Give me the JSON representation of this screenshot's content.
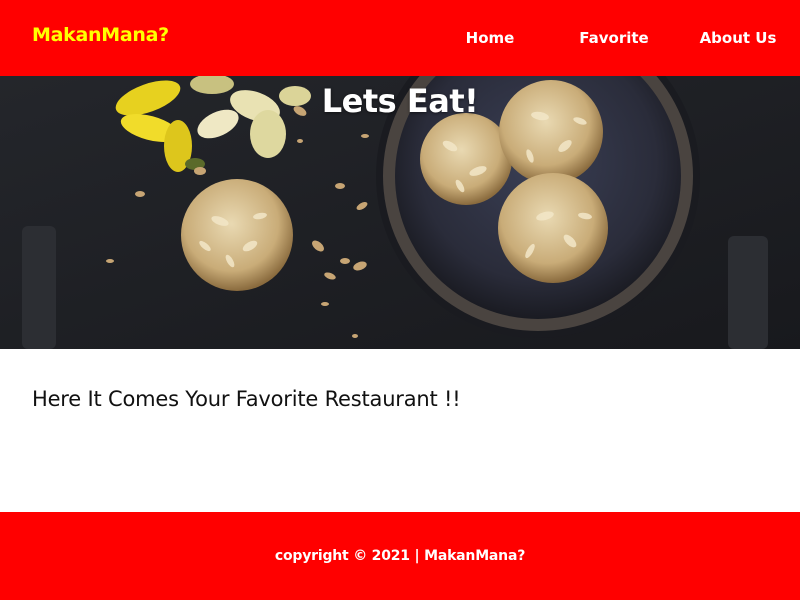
{
  "header": {
    "brand": "MakanMana?",
    "nav": [
      {
        "label": "Home"
      },
      {
        "label": "Favorite"
      },
      {
        "label": "About Us"
      }
    ]
  },
  "hero": {
    "title": "Lets Eat!",
    "image_alt": "cookies-with-almonds-and-daffodils"
  },
  "main": {
    "heading": "Here It Comes Your Favorite Restaurant !!"
  },
  "footer": {
    "copyright": "copyright © 2021 | MakanMana?"
  },
  "colors": {
    "primary": "#ff0000",
    "brand_text": "#ffff00",
    "nav_text": "#ffffff",
    "hero_bg": "#1d1f23"
  }
}
